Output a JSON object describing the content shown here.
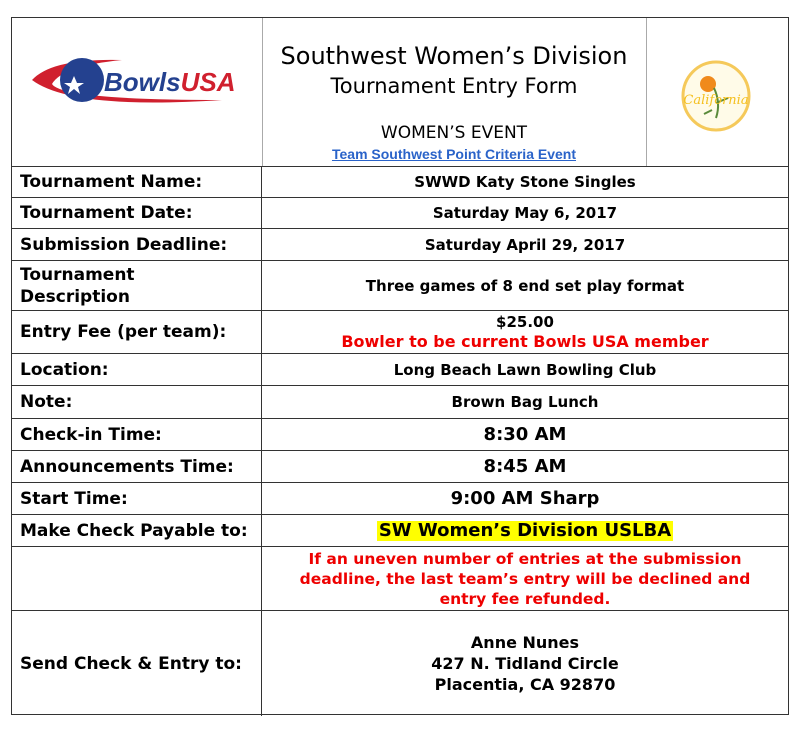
{
  "header": {
    "logo_left": "BowlsUSA",
    "logo_right": "SWD California Women's",
    "title": "Southwest Women’s Division",
    "subtitle": "Tournament Entry Form",
    "event": "WOMEN’S EVENT",
    "link": "Team Southwest Point Criteria Event"
  },
  "rows": [
    {
      "label": "Tournament Name:",
      "value": "SWWD Katy Stone Singles"
    },
    {
      "label": "Tournament Date:",
      "value": "Saturday May 6, 2017"
    },
    {
      "label": "Submission Deadline:",
      "value": "Saturday April 29, 2017"
    },
    {
      "label": "Tournament Description",
      "value": "Three games of 8 end set play format"
    },
    {
      "label": "Entry Fee (per team):",
      "value": "$25.00",
      "note": "Bowler to be current Bowls USA member"
    },
    {
      "label": "Location:",
      "value": "Long Beach Lawn Bowling Club"
    },
    {
      "label": "Note:",
      "value": "Brown Bag Lunch"
    },
    {
      "label": "Check-in Time:",
      "value": "8:30 AM"
    },
    {
      "label": "Announcements Time:",
      "value": "8:45 AM"
    },
    {
      "label": "Start Time:",
      "value": "9:00 AM Sharp"
    },
    {
      "label": "Make Check Payable to:",
      "value": "SW Women’s Division USLBA"
    },
    {
      "label": "",
      "value": "If an uneven number of entries at the submission deadline, the last team’s entry will be declined and entry fee refunded."
    },
    {
      "label": "Send Check & Entry to:",
      "lines": [
        "Anne Nunes",
        "427 N. Tidland Circle",
        "Placentia, CA 92870"
      ]
    }
  ]
}
